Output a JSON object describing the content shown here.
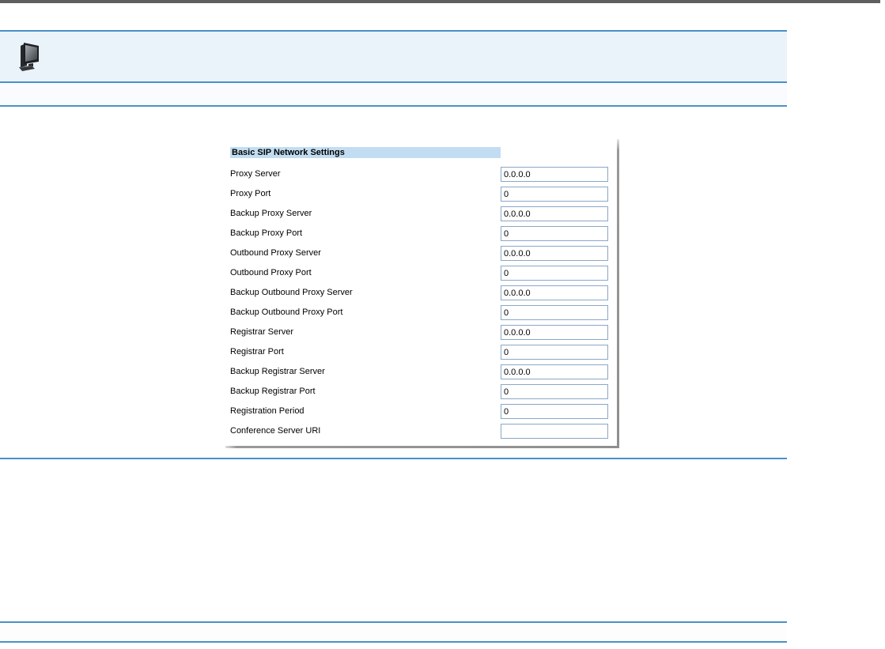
{
  "header": {
    "icon": "computer-workstation-icon"
  },
  "colors": {
    "top_bar": "#5f5f5f",
    "accent_line": "#4a90c8",
    "band_light_blue": "#eaf2fa",
    "band_faint_blue": "#f9fbfe",
    "section_header_bg": "#c2ddf2",
    "input_border": "#8ba7c7",
    "panel_shadow": "#9a9a9a"
  },
  "panel": {
    "section_title": "Basic SIP Network Settings",
    "rows": [
      {
        "label": "Proxy Server",
        "value": "0.0.0.0"
      },
      {
        "label": "Proxy Port",
        "value": "0"
      },
      {
        "label": "Backup Proxy Server",
        "value": "0.0.0.0"
      },
      {
        "label": "Backup Proxy Port",
        "value": "0"
      },
      {
        "label": "Outbound Proxy Server",
        "value": "0.0.0.0"
      },
      {
        "label": "Outbound Proxy Port",
        "value": "0"
      },
      {
        "label": "Backup Outbound Proxy Server",
        "value": "0.0.0.0"
      },
      {
        "label": "Backup Outbound Proxy Port",
        "value": "0"
      },
      {
        "label": "Registrar Server",
        "value": "0.0.0.0"
      },
      {
        "label": "Registrar Port",
        "value": "0"
      },
      {
        "label": "Backup Registrar Server",
        "value": "0.0.0.0"
      },
      {
        "label": "Backup Registrar Port",
        "value": "0"
      },
      {
        "label": "Registration Period",
        "value": "0"
      },
      {
        "label": "Conference Server URI",
        "value": ""
      }
    ]
  }
}
